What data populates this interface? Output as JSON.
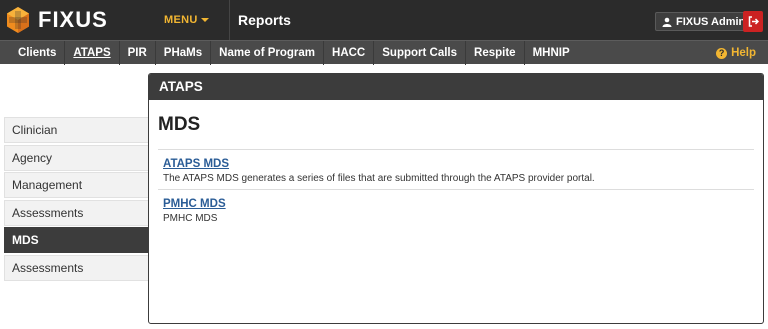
{
  "app": {
    "brand": "FIXUS",
    "menu_label": "MENU",
    "section_title": "Reports",
    "user_label": "FIXUS Admin"
  },
  "nav": {
    "items": [
      "Clients",
      "ATAPS",
      "PIR",
      "PHaMs",
      "Name of Program",
      "HACC",
      "Support Calls",
      "Respite",
      "MHNIP"
    ],
    "active": "ATAPS",
    "help_label": "Help"
  },
  "sidebar": {
    "items": [
      "Clinician",
      "Agency",
      "Management",
      "Assessments",
      "MDS",
      "Assessments"
    ],
    "active_index": 4
  },
  "panel": {
    "header": "ATAPS",
    "title": "MDS",
    "reports": [
      {
        "title": "ATAPS MDS",
        "description": "The ATAPS MDS generates a series of files that are submitted through the ATAPS provider portal."
      },
      {
        "title": "PMHC MDS",
        "description": "PMHC MDS"
      }
    ]
  },
  "colors": {
    "topbar": "#2b2b2b",
    "navbar": "#4a4a4a",
    "accent": "#f2b632",
    "logout": "#cc2222",
    "link": "#2a5c96",
    "panel_header": "#3c3c3c"
  }
}
